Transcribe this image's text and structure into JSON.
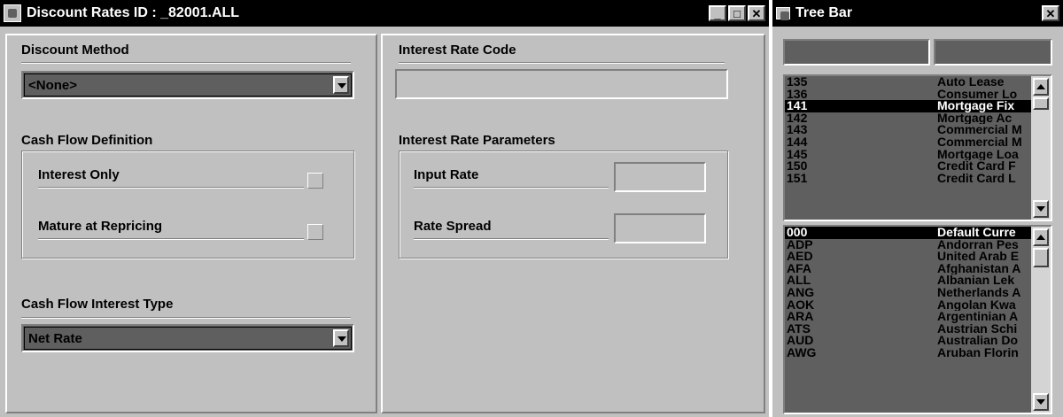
{
  "main_window": {
    "title": "Discount Rates ID : _82001.ALL",
    "buttons": {
      "minimize": "_",
      "maximize": "□",
      "close": "✕"
    }
  },
  "left": {
    "discount_method_label": "Discount Method",
    "discount_method_value": "<None>",
    "cash_flow_definition_label": "Cash Flow Definition",
    "interest_only_label": "Interest Only",
    "mature_at_repricing_label": "Mature at Repricing",
    "cash_flow_interest_type_label": "Cash Flow Interest Type",
    "cash_flow_interest_type_value": "Net Rate"
  },
  "right": {
    "interest_rate_code_label": "Interest Rate Code",
    "interest_rate_code_value": "",
    "interest_rate_parameters_label": "Interest Rate Parameters",
    "input_rate_label": "Input Rate",
    "input_rate_value": "",
    "rate_spread_label": "Rate Spread",
    "rate_spread_value": ""
  },
  "tree_window": {
    "title": "Tree Bar",
    "close": "✕",
    "codes": [
      {
        "code": "135",
        "name": "Auto Lease"
      },
      {
        "code": "136",
        "name": "Consumer Lo"
      },
      {
        "code": "141",
        "name": "Mortgage Fix",
        "selected": true
      },
      {
        "code": "142",
        "name": "Mortgage  Ac"
      },
      {
        "code": "143",
        "name": "Commercial M"
      },
      {
        "code": "144",
        "name": "Commercial M"
      },
      {
        "code": "145",
        "name": "Mortgage Loa"
      },
      {
        "code": "150",
        "name": "Credit Card F"
      },
      {
        "code": "151",
        "name": "Credit Card L"
      }
    ],
    "currencies": [
      {
        "code": "000",
        "name": "Default Curre",
        "selected": true
      },
      {
        "code": "ADP",
        "name": "Andorran Pes"
      },
      {
        "code": "AED",
        "name": "United Arab E"
      },
      {
        "code": "AFA",
        "name": "Afghanistan A"
      },
      {
        "code": "ALL",
        "name": "Albanian Lek"
      },
      {
        "code": "ANG",
        "name": "Netherlands A"
      },
      {
        "code": "AOK",
        "name": "Angolan Kwa"
      },
      {
        "code": "ARA",
        "name": "Argentinian A"
      },
      {
        "code": "ATS",
        "name": "Austrian Schi"
      },
      {
        "code": "AUD",
        "name": "Australian Do"
      },
      {
        "code": "AWG",
        "name": "Aruban Florin"
      }
    ]
  }
}
